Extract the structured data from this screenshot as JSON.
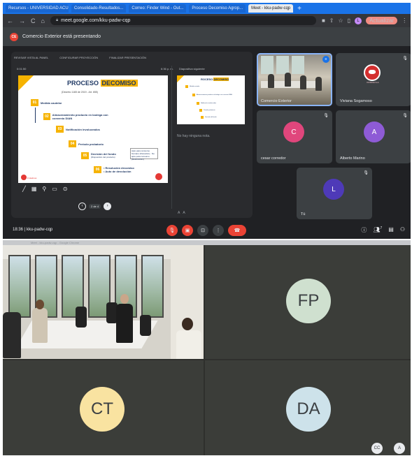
{
  "browser": {
    "tabs": [
      "Recursos - UNIVERSIDAD ACU...",
      "Consolidado-Resultados...",
      "Correo: Finder Wind - Out...",
      "Proceso Decomiso Agrop...",
      "Meet - kku-padw-cqp"
    ],
    "url": "meet.google.com/kku-padw-cqp",
    "update_label": "Actualizar",
    "profile_initial": "L"
  },
  "presenting": {
    "badge": "CE",
    "text": "Comercio Exterior está presentando"
  },
  "presenter_view": {
    "toolbar": [
      "REVISAR VISTA AL PANEL",
      "CONFIGURAR PROYECCIÓN",
      "FINALIZAR PRESENTACIÓN"
    ],
    "elapsed": "0:01:50",
    "slide_count": "6:36 p. m.",
    "next_label": "Diapositiva siguiente",
    "notes": "No hay ninguna nota.",
    "page_indicator": "2 de 4"
  },
  "slide": {
    "title_plain": "PROCESO ",
    "title_highlight": "DECOMISO",
    "subtitle": "(Decreto 1165 de 2019 - Art. 655)",
    "steps": [
      {
        "num": "01",
        "text": "Medida cautelar"
      },
      {
        "num": "02",
        "text": "Almacenamiento producto en bodega con convenio DIAN"
      },
      {
        "num": "03",
        "text": "Notificación involucrados"
      },
      {
        "num": "04",
        "text": "Periodo probatorio"
      },
      {
        "num": "05",
        "text": "Decisión del fondo"
      },
      {
        "num": "06",
        "text": "• Resolución decomiso\n• Auto de devolución"
      }
    ],
    "step5_note": "(Disposición del producto)",
    "side_box": "Apto para consumo humano (Donación) · No apto para consumo (Destrucción)",
    "footer_left": "Frutalmas"
  },
  "next_slide": {
    "title_plain": "ROCESO ",
    "title_highlight": "DECOMISO",
    "lines": [
      "Medida cautelar",
      "Almacenamiento producto en bodega con convenio DIAN",
      "Notificación involucrados",
      "Periodo probatorio",
      "Decisión del fondo"
    ]
  },
  "participants_top": [
    {
      "name": "Comercio Exterior",
      "type": "video",
      "speaking": true
    },
    {
      "name": "Viviana Sogamoso",
      "type": "logo",
      "logo_text": "VIVIANA S.A."
    },
    {
      "name": "cesar corredor",
      "type": "avatar",
      "initial": "C",
      "color": "#e0467c"
    },
    {
      "name": "Alberto Marino",
      "type": "avatar",
      "initial": "A",
      "color": "#8e5bd6"
    },
    {
      "name": "Tú",
      "type": "avatar",
      "initial": "L",
      "color": "#4e3ab8"
    }
  ],
  "callbar": {
    "time": "18:36",
    "separator": "|",
    "meeting_code": "kku-padw-cqp",
    "participants_count": "7"
  },
  "grid": {
    "top_strip_text": "Meet - kku-padw-cqp - Google Chrome",
    "tiles": [
      {
        "type": "video"
      },
      {
        "type": "avatar",
        "initials": "FP",
        "color": "#cfe0cf"
      },
      {
        "type": "avatar",
        "initials": "CT",
        "color": "#f9e3a1"
      },
      {
        "type": "avatar",
        "initials": "DA",
        "color": "#cde2ea"
      }
    ],
    "chips": [
      "CC",
      "A"
    ]
  },
  "colors": {
    "accent": "#1a73e8",
    "end_call": "#ea4335",
    "slide_yellow": "#f6b300",
    "slide_navy": "#1f3864"
  }
}
